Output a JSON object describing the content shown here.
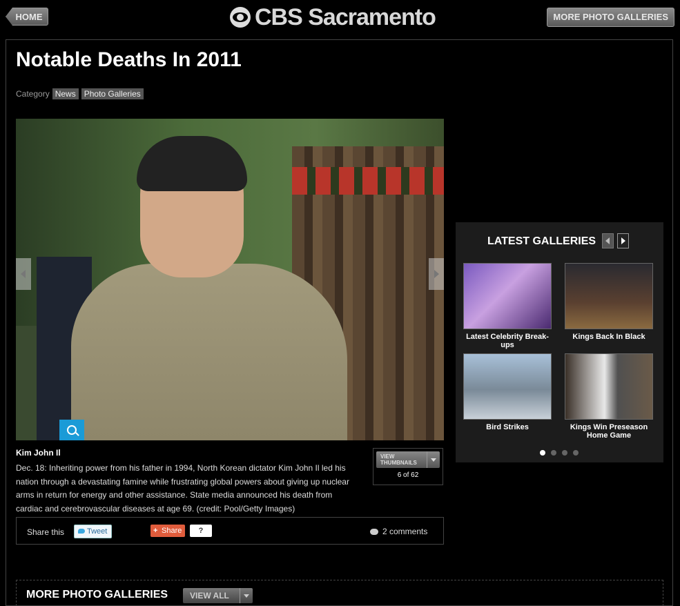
{
  "header": {
    "home_label": "HOME",
    "logo_text": "CBS Sacramento",
    "more_galleries_label": "MORE PHOTO GALLERIES"
  },
  "article": {
    "title": "Notable Deaths In 2011",
    "category_label": "Category",
    "categories": [
      "News",
      "Photo Galleries"
    ]
  },
  "photo": {
    "caption_title": "Kim John Il",
    "caption_text": "Dec. 18: Inheriting power from his father in 1994, North Korean dictator Kim John Il led his nation through a devastating famine while frustrating global powers about giving up nuclear arms in return for energy and other assistance. State media announced his death from cardiac and cerebrovascular diseases at age 69. (credit: Pool/Getty Images)",
    "view_thumbnails_line1": "VIEW",
    "view_thumbnails_line2": "THUMBNAILS",
    "counter": "6 of 62"
  },
  "share": {
    "label": "Share this",
    "tweet_label": "Tweet",
    "share_label": "Share",
    "share_count": "?",
    "comments": "2 comments"
  },
  "latest": {
    "title": "LATEST GALLERIES",
    "items": [
      {
        "caption": "Latest Celebrity Break-ups",
        "color": "#6a4aa0"
      },
      {
        "caption": "Kings Back In Black",
        "color": "#4a3a2a"
      },
      {
        "caption": "Bird Strikes",
        "color": "#8aa4b8"
      },
      {
        "caption": "Kings Win Preseason Home Game",
        "color": "#3a3028"
      }
    ],
    "active_page": 1,
    "page_count": 4
  },
  "more_galleries": {
    "title": "MORE PHOTO GALLERIES",
    "view_all_label": "VIEW ALL"
  }
}
